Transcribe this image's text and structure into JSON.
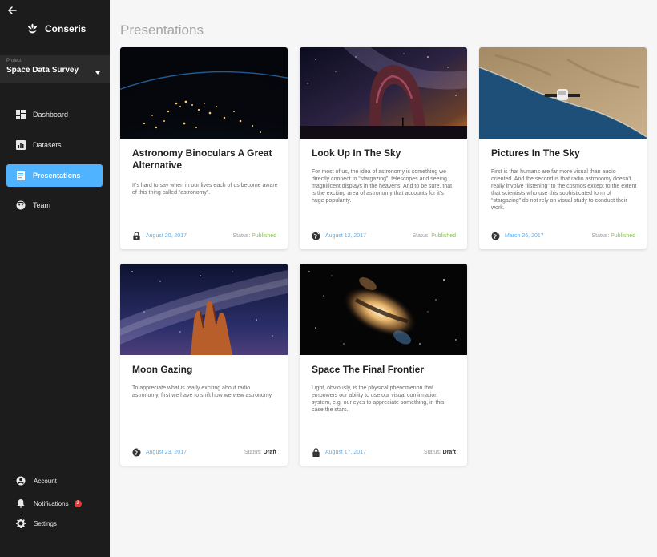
{
  "app": {
    "name": "Conseris"
  },
  "project": {
    "caption": "Project",
    "name": "Space Data Survey"
  },
  "nav": [
    {
      "label": "Dashboard",
      "icon": "dashboard-icon"
    },
    {
      "label": "Datasets",
      "icon": "bar-chart-icon"
    },
    {
      "label": "Presentations",
      "icon": "presentation-icon",
      "active": true
    },
    {
      "label": "Team",
      "icon": "team-icon"
    }
  ],
  "footer_nav": [
    {
      "label": "Account",
      "icon": "account-icon"
    },
    {
      "label": "Notifications",
      "icon": "bell-icon",
      "badge": "3"
    },
    {
      "label": "Settings",
      "icon": "gear-icon"
    }
  ],
  "page": {
    "title": "Presentations"
  },
  "status_label": "Status:",
  "cards": [
    {
      "title": "Astronomy Binoculars A Great Alternative",
      "desc": "It’s hard to say when in our lives each of us become aware of this thing called “astronomy”.",
      "date": "August 20, 2017",
      "status": "Published",
      "visibility": "lock-icon",
      "image": "earth-at-night"
    },
    {
      "title": "Look Up In The Sky",
      "desc": "For most of us, the idea of astronomy is something we directly connect to “stargazing”, telescopes and seeing magnificent displays in the heavens. And to be sure, that is the exciting area of astronomy that accounts for it’s huge popularity.",
      "date": "August 12, 2017",
      "status": "Published",
      "visibility": "globe-icon",
      "image": "arch-milky-way"
    },
    {
      "title": "Pictures In The Sky",
      "desc": "First is that humans are far more visual than audio oriented. And the second is that radio astronomy doesn’t really involve “listening” to the cosmos except to the extent that scientists who use this sophisticated form of “stargazing” do not rely on visual study to conduct their work.",
      "date": "March 26, 2017",
      "status": "Published",
      "visibility": "globe-icon",
      "image": "satellite-over-coast"
    },
    {
      "title": "Moon Gazing",
      "desc": "To appreciate what is really exciting about radio astronomy, first we have to shift how we view astronomy.",
      "date": "August 23, 2017",
      "status": "Draft",
      "visibility": "globe-icon",
      "image": "rock-spires-milky-way"
    },
    {
      "title": "Space The Final Frontier",
      "desc": "Light, obviously, is the physical phenomenon that empowers our ability to use our visual confirmation system, e.g. our eyes to appreciate something, in this case the stars.",
      "date": "August 17, 2017",
      "status": "Draft",
      "visibility": "lock-icon",
      "image": "galaxy"
    }
  ],
  "colors": {
    "accent": "#4fb3ff",
    "sidebar": "#1c1c1c",
    "published": "#8bc34a",
    "badge": "#e53935"
  }
}
